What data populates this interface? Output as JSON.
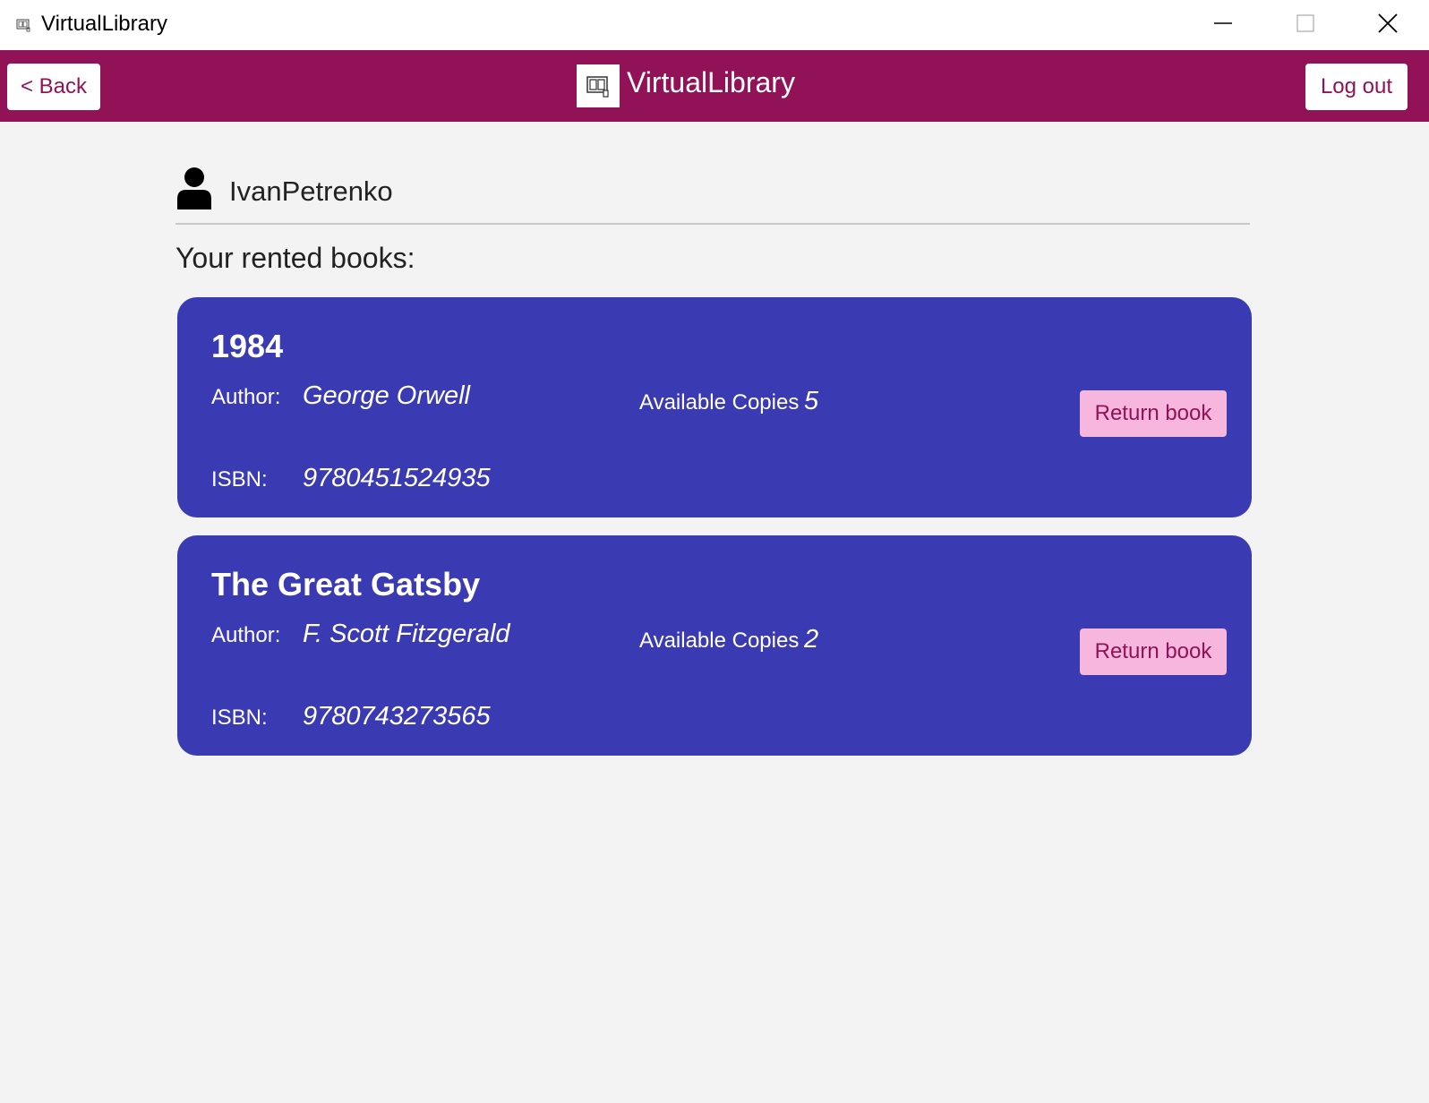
{
  "window": {
    "title": "VirtualLibrary",
    "icon": "book-app-icon",
    "controls": [
      "minimize-icon",
      "maximize-icon",
      "close-icon"
    ]
  },
  "header": {
    "back_label": "< Back",
    "brand_title": "VirtualLibrary",
    "logout_label": "Log out",
    "accent_color": "#911256"
  },
  "user": {
    "name": "IvanPetrenko",
    "icon": "user-icon"
  },
  "section_title": "Your rented books:",
  "books": [
    {
      "title": "1984",
      "author_label": "Author:",
      "author": "George Orwell",
      "copies_label": "Available Copies",
      "copies": "5",
      "isbn_label": "ISBN:",
      "isbn": "9780451524935",
      "action_label": "Return book"
    },
    {
      "title": "The Great Gatsby",
      "author_label": "Author:",
      "author": "F. Scott Fitzgerald",
      "copies_label": "Available Copies",
      "copies": "2",
      "isbn_label": "ISBN:",
      "isbn": "9780743273565",
      "action_label": "Return book"
    }
  ],
  "colors": {
    "card_background": "#3a3ab3",
    "button_background": "#f7b6dd",
    "page_background": "#f3f3f3"
  }
}
